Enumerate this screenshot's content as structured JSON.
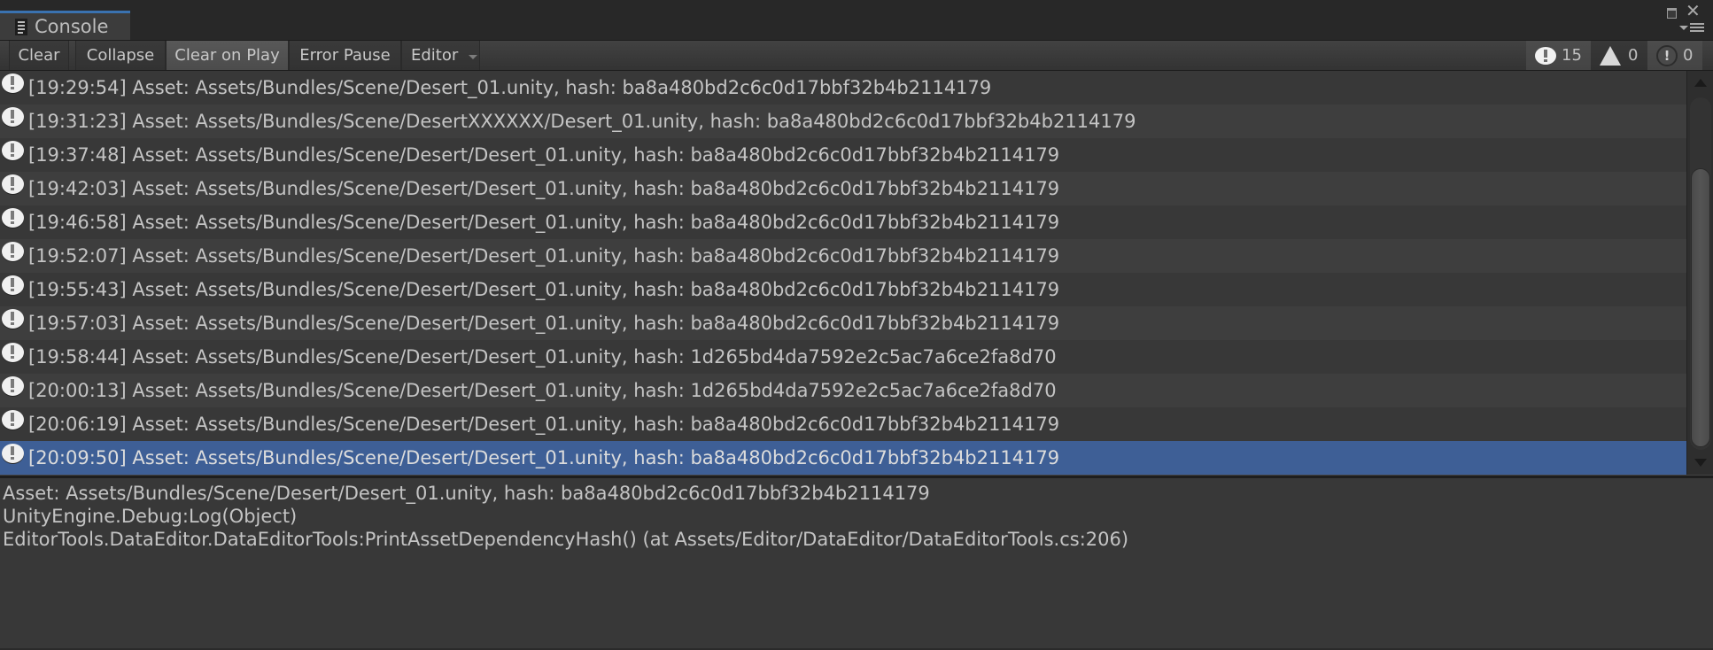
{
  "window": {
    "tab_label": "Console",
    "tab_icon": "console-document-icon",
    "controls": [
      "maximize-icon",
      "close-icon",
      "panel-menu-icon"
    ]
  },
  "toolbar": {
    "clear_label": "Clear",
    "collapse_label": "Collapse",
    "clear_on_play_label": "Clear on Play",
    "clear_on_play_active": true,
    "error_pause_label": "Error Pause",
    "editor_label": "Editor",
    "counters": {
      "log": "15",
      "warning": "0",
      "error": "0"
    }
  },
  "log_entries": [
    {
      "time": "[19:29:54]",
      "message": "Asset: Assets/Bundles/Scene/Desert_01.unity, hash: ba8a480bd2c6c0d17bbf32b4b2114179"
    },
    {
      "time": "[19:31:23]",
      "message": "Asset: Assets/Bundles/Scene/DesertXXXXXX/Desert_01.unity, hash: ba8a480bd2c6c0d17bbf32b4b2114179"
    },
    {
      "time": "[19:37:48]",
      "message": "Asset: Assets/Bundles/Scene/Desert/Desert_01.unity, hash: ba8a480bd2c6c0d17bbf32b4b2114179"
    },
    {
      "time": "[19:42:03]",
      "message": "Asset: Assets/Bundles/Scene/Desert/Desert_01.unity, hash: ba8a480bd2c6c0d17bbf32b4b2114179"
    },
    {
      "time": "[19:46:58]",
      "message": "Asset: Assets/Bundles/Scene/Desert/Desert_01.unity, hash: ba8a480bd2c6c0d17bbf32b4b2114179"
    },
    {
      "time": "[19:52:07]",
      "message": "Asset: Assets/Bundles/Scene/Desert/Desert_01.unity, hash: ba8a480bd2c6c0d17bbf32b4b2114179"
    },
    {
      "time": "[19:55:43]",
      "message": "Asset: Assets/Bundles/Scene/Desert/Desert_01.unity, hash: ba8a480bd2c6c0d17bbf32b4b2114179"
    },
    {
      "time": "[19:57:03]",
      "message": "Asset: Assets/Bundles/Scene/Desert/Desert_01.unity, hash: ba8a480bd2c6c0d17bbf32b4b2114179"
    },
    {
      "time": "[19:58:44]",
      "message": "Asset: Assets/Bundles/Scene/Desert/Desert_01.unity, hash: 1d265bd4da7592e2c5ac7a6ce2fa8d70"
    },
    {
      "time": "[20:00:13]",
      "message": "Asset: Assets/Bundles/Scene/Desert/Desert_01.unity, hash: 1d265bd4da7592e2c5ac7a6ce2fa8d70"
    },
    {
      "time": "[20:06:19]",
      "message": "Asset: Assets/Bundles/Scene/Desert/Desert_01.unity, hash: ba8a480bd2c6c0d17bbf32b4b2114179"
    },
    {
      "time": "[20:09:50]",
      "message": "Asset: Assets/Bundles/Scene/Desert/Desert_01.unity, hash: ba8a480bd2c6c0d17bbf32b4b2114179",
      "selected": true
    }
  ],
  "detail": {
    "lines": [
      "Asset: Assets/Bundles/Scene/Desert/Desert_01.unity, hash: ba8a480bd2c6c0d17bbf32b4b2114179",
      "UnityEngine.Debug:Log(Object)",
      "EditorTools.DataEditor.DataEditorTools:PrintAssetDependencyHash() (at Assets/Editor/DataEditor/DataEditorTools.cs:206)"
    ]
  },
  "colors": {
    "selection": "#3e5f96",
    "tab_accent": "#3a72b0",
    "background": "#383838"
  }
}
